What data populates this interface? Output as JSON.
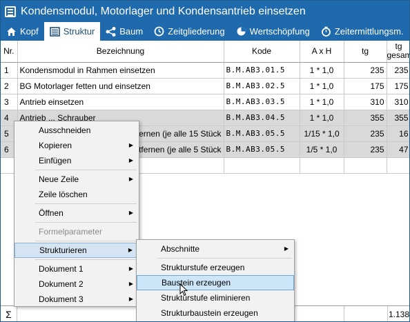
{
  "window": {
    "title": "Kondensmodul, Motorlager und Kondensantrieb einsetzen"
  },
  "tabs": [
    {
      "label": "Kopf",
      "icon": "home-icon",
      "active": false
    },
    {
      "label": "Struktur",
      "icon": "structure-icon",
      "active": true
    },
    {
      "label": "Baum",
      "icon": "tree-share-icon",
      "active": false
    },
    {
      "label": "Zeitgliederung",
      "icon": "clock-icon",
      "active": false
    },
    {
      "label": "Wertschöpfung",
      "icon": "pie-chart-icon",
      "active": false
    },
    {
      "label": "Zeitermittlungsm.",
      "icon": "stopwatch-icon",
      "active": false
    }
  ],
  "table": {
    "headers": {
      "nr": "Nr.",
      "bezeichnung": "Bezeichnung",
      "kode": "Kode",
      "axh": "A x H",
      "tg": "tg",
      "tg_gesamt_line1": "tg",
      "tg_gesamt_line2": "gesamt"
    },
    "rows": [
      {
        "nr": "1",
        "bezeichnung": "Kondensmodul in Rahmen einsetzen",
        "kode": "B.M.AB3.01.5",
        "axh": "1 * 1,0",
        "tg": "235",
        "tg_gesamt": "235"
      },
      {
        "nr": "2",
        "bezeichnung": "BG Motorlager fetten und einsetzen",
        "kode": "B.M.AB3.02.5",
        "axh": "1 * 1,0",
        "tg": "175",
        "tg_gesamt": "175"
      },
      {
        "nr": "3",
        "bezeichnung": "Antrieb einsetzen",
        "kode": "B.M.AB3.03.5",
        "axh": "1 * 1,0",
        "tg": "310",
        "tg_gesamt": "310"
      },
      {
        "nr": "4",
        "bezeichnung": "Antrieb ... Schrauber",
        "kode": "B.M.AB3.04.5",
        "axh": "1 * 1,0",
        "tg": "355",
        "tg_gesamt": "355"
      },
      {
        "nr": "5",
        "bezeichnung": "...ntfernen (je alle 15 Stück",
        "kode": "B.M.AB3.05.5",
        "axh": "1/15 * 1,0",
        "tg": "235",
        "tg_gesamt": "16"
      },
      {
        "nr": "6",
        "bezeichnung": "...ntfernen (je alle 5 Stück",
        "kode": "B.M.AB3.05.5",
        "axh": "1/5 * 1,0",
        "tg": "235",
        "tg_gesamt": "47"
      }
    ],
    "sum_symbol": "Σ",
    "sum_value": "1.138"
  },
  "context_menu": {
    "items": [
      {
        "label": "Ausschneiden",
        "submenu": false,
        "disabled": false
      },
      {
        "label": "Kopieren",
        "submenu": true,
        "disabled": false
      },
      {
        "label": "Einfügen",
        "submenu": true,
        "disabled": false
      },
      {
        "label": "Neue Zeile",
        "submenu": true,
        "disabled": false
      },
      {
        "label": "Zeile löschen",
        "submenu": false,
        "disabled": false
      },
      {
        "label": "Öffnen",
        "submenu": true,
        "disabled": false
      },
      {
        "label": "Formelparameter",
        "submenu": false,
        "disabled": true
      },
      {
        "label": "Strukturieren",
        "submenu": true,
        "disabled": false,
        "highlighted": true
      },
      {
        "label": "Dokument 1",
        "submenu": true,
        "disabled": false
      },
      {
        "label": "Dokument 2",
        "submenu": true,
        "disabled": false
      },
      {
        "label": "Dokument 3",
        "submenu": true,
        "disabled": false
      }
    ]
  },
  "submenu": {
    "items": [
      {
        "label": "Abschnitte",
        "submenu": true
      },
      {
        "label": "Strukturstufe erzeugen",
        "submenu": false
      },
      {
        "label": "Baustein erzeugen",
        "submenu": false,
        "highlighted": true
      },
      {
        "label": "Strukturstufe eliminieren",
        "submenu": false
      },
      {
        "label": "Strukturbaustein erzeugen",
        "submenu": false
      }
    ]
  },
  "colors": {
    "titlebar": "#1e6aad",
    "selection": "#d9d9d9",
    "menu_bg": "#f2f2f2",
    "highlight": "#cde6f7"
  }
}
